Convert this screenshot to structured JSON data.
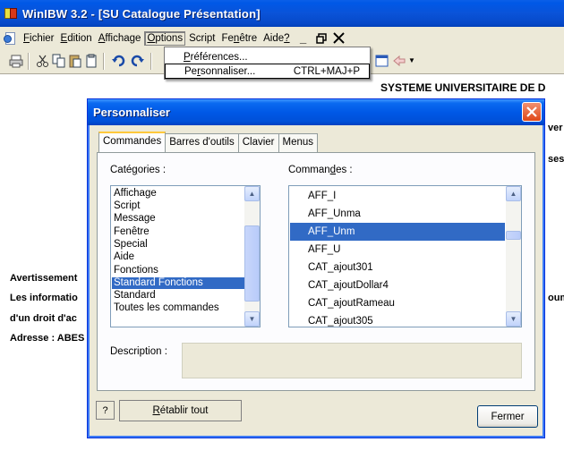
{
  "window": {
    "title": "WinIBW 3.2 - [SU Catalogue Présentation]"
  },
  "menubar": {
    "items": [
      {
        "label": "Fichier",
        "ul": "F",
        "rest": "ichier"
      },
      {
        "label": "Edition",
        "ul": "E",
        "rest": "dition"
      },
      {
        "label": "Affichage",
        "ul": "A",
        "rest": "ffichage"
      },
      {
        "label": "Options",
        "ul": "O",
        "rest": "ptions"
      },
      {
        "label": "Script",
        "ul": "",
        "rest": "Script"
      },
      {
        "label": "Fenêtre",
        "pre": "Fe",
        "ul": "n",
        "rest": "être"
      },
      {
        "label": "Aide?",
        "pre": "Aide",
        "ul": "?",
        "rest": ""
      }
    ],
    "mdi_buttons": [
      "_",
      "🗗",
      "✕"
    ]
  },
  "options_menu": {
    "items": [
      {
        "label": "Préférences...",
        "ul": "P",
        "rest": "références...",
        "accel": ""
      },
      {
        "label": "Personnaliser...",
        "pre": "Pe",
        "ul": "r",
        "rest": "sonnaliser...",
        "accel": "CTRL+MAJ+P"
      }
    ]
  },
  "document": {
    "header": "SYSTEME UNIVERSITAIRE DE D",
    "fragments": {
      "avertissement": "Avertissement",
      "informations": "Les informatio",
      "droit": "d'un droit d'ac",
      "adresse": "Adresse : ABES",
      "right1": "ver",
      "right2": "ses,",
      "right3": "oum"
    }
  },
  "dialog": {
    "title": "Personnaliser",
    "tabs": [
      "Commandes",
      "Barres d'outils",
      "Clavier",
      "Menus"
    ],
    "active_tab": "Commandes",
    "categories_label": {
      "pre": "Caté",
      "ul": "g",
      "rest": "ories :"
    },
    "commands_label": {
      "pre": "Comman",
      "ul": "d",
      "rest": "es :"
    },
    "categories": [
      "Affichage",
      "Script",
      "Message",
      "Fenêtre",
      "Special",
      "Aide",
      "Fonctions",
      "Standard Fonctions",
      "Standard",
      "Toutes les commandes"
    ],
    "selected_category": "Standard Fonctions",
    "commands": [
      "AFF_I",
      "AFF_Unma",
      "AFF_Unm",
      "AFF_U",
      "CAT_ajout301",
      "CAT_ajoutDollar4",
      "CAT_ajoutRameau",
      "CAT_ajout305"
    ],
    "selected_command": "AFF_Unm",
    "description_label": "Description :",
    "reset_button": {
      "ul": "R",
      "rest": "établir tout"
    },
    "close_button": "Fermer",
    "help_icon": "?"
  },
  "colors": {
    "title_blue": "#0058e6",
    "selection": "#316ac5",
    "dialog_bg": "#ece9d8"
  }
}
